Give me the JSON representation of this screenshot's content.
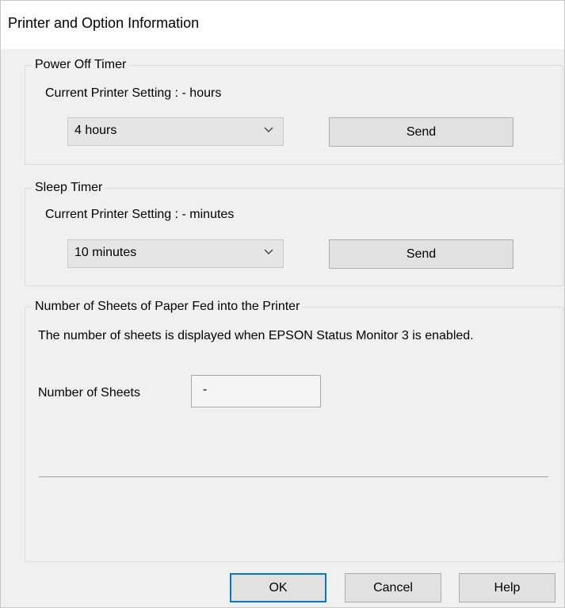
{
  "window": {
    "title": "Printer and Option Information"
  },
  "power_off_timer": {
    "legend": "Power Off Timer",
    "current_setting": "Current Printer Setting : - hours",
    "selected": "4 hours",
    "send_label": "Send"
  },
  "sleep_timer": {
    "legend": "Sleep Timer",
    "current_setting": "Current Printer Setting : - minutes",
    "selected": "10 minutes",
    "send_label": "Send"
  },
  "sheets": {
    "legend": "Number of Sheets of Paper Fed into the Printer",
    "description": "The number of sheets is displayed when EPSON Status Monitor 3 is enabled.",
    "label": "Number of Sheets",
    "value": "-"
  },
  "footer": {
    "ok_label": "OK",
    "cancel_label": "Cancel",
    "help_label": "Help"
  },
  "icons": {
    "dropdown": "chevron-down-icon"
  }
}
